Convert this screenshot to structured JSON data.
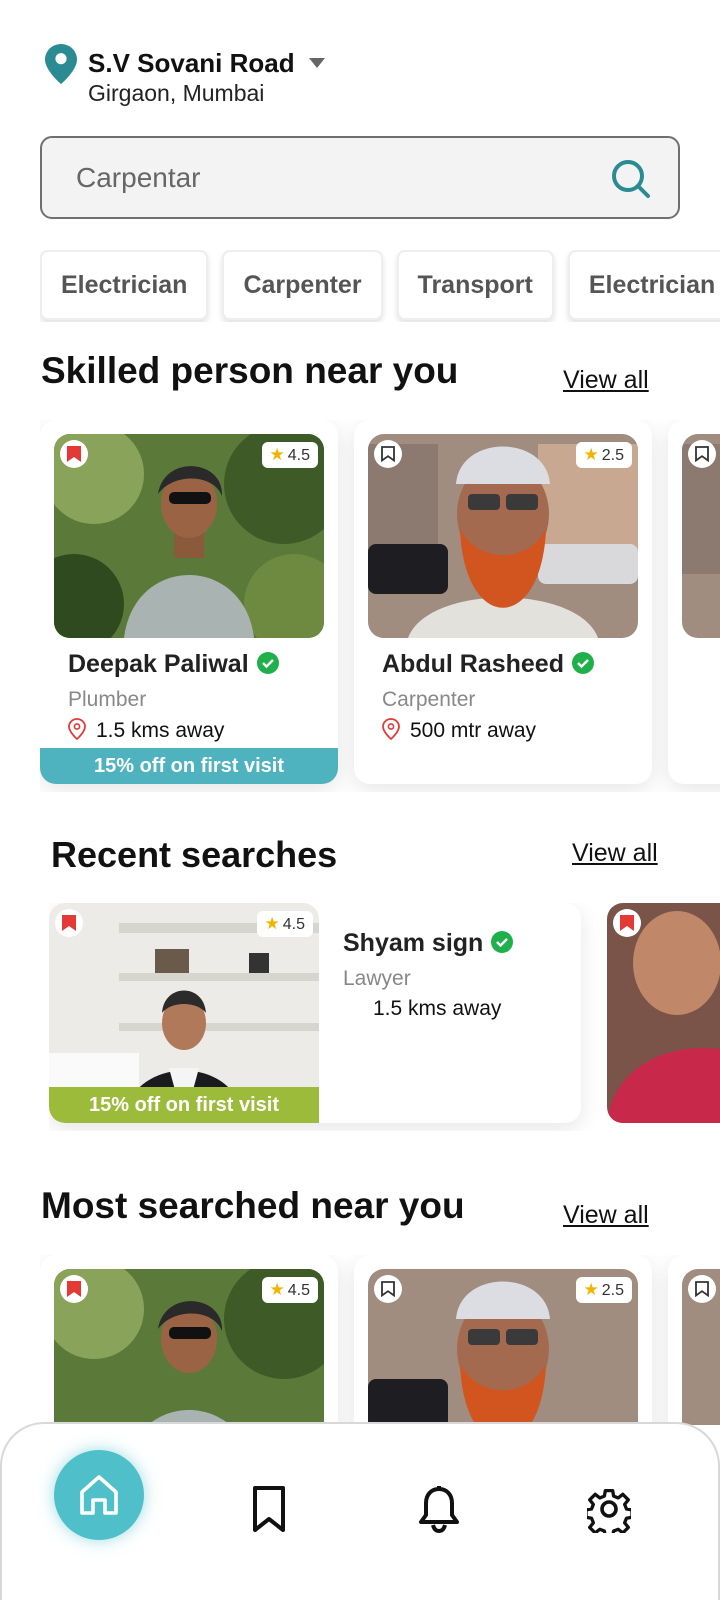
{
  "location": {
    "title": "S.V Sovani Road",
    "subtitle": "Girgaon, Mumbai"
  },
  "search": {
    "placeholder": "Carpentar"
  },
  "categories": [
    "Electrician",
    "Carpenter",
    "Transport",
    "Electrician"
  ],
  "sections": {
    "skilled": {
      "title": "Skilled person near you",
      "view_all": "View all"
    },
    "recent": {
      "title": "Recent searches",
      "view_all": "View all"
    },
    "most": {
      "title": "Most searched near you",
      "view_all": "View all"
    }
  },
  "skilled_cards": [
    {
      "name": "Deepak Paliwal",
      "role": "Plumber",
      "distance": "1.5 kms away",
      "rating": "4.5",
      "promo": "15% off on first visit",
      "saved": true
    },
    {
      "name": "Abdul Rasheed",
      "role": "Carpenter",
      "distance": "500 mtr away",
      "rating": "2.5",
      "promo": "",
      "saved": false
    }
  ],
  "recent_cards": [
    {
      "name": "Shyam sign",
      "role": "Lawyer",
      "distance": "1.5 kms away",
      "rating": "4.5",
      "promo": "15% off on first visit",
      "saved": true
    }
  ],
  "most_cards": [
    {
      "rating": "4.5",
      "saved": true
    },
    {
      "rating": "2.5",
      "saved": false
    }
  ],
  "colors": {
    "teal": "#4fb3bf",
    "green_promo": "#9dbb3a",
    "bookmark_red": "#e53935",
    "verified_green": "#20b04b"
  },
  "nav": [
    "home-icon",
    "bookmark-icon",
    "bell-icon",
    "gear-icon"
  ]
}
